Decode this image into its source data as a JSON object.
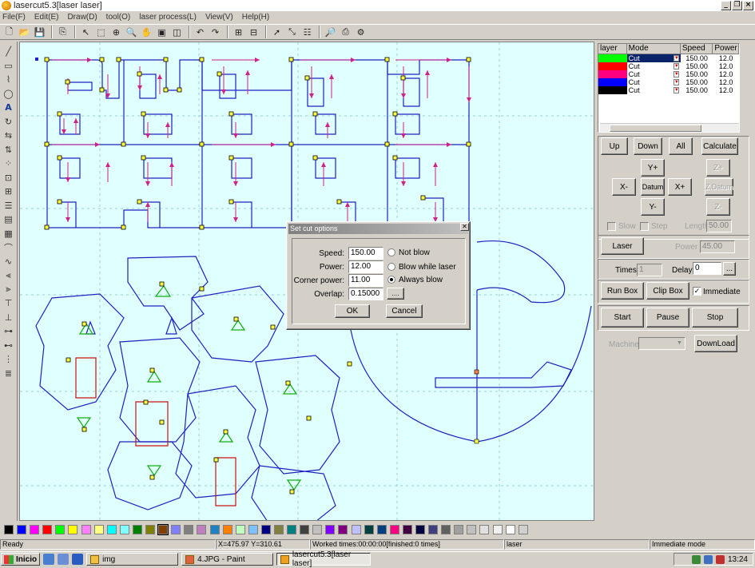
{
  "window": {
    "title": "lasercut5.3[laser laser]",
    "buttons": [
      "_",
      "❐",
      "×"
    ]
  },
  "menu": [
    "File(F)",
    "Edit(E)",
    "Draw(D)",
    "tool(O)",
    "laser process(L)",
    "View(V)",
    "Help(H)"
  ],
  "layers": {
    "headers": [
      "layer",
      "Mode",
      "Speed",
      "Power"
    ],
    "rows": [
      {
        "color": "#00ff00",
        "mode": "Cut",
        "speed": "150.00",
        "power": "12.0"
      },
      {
        "color": "#ff0000",
        "mode": "Cut",
        "speed": "150.00",
        "power": "12.0"
      },
      {
        "color": "#ff0080",
        "mode": "Cut",
        "speed": "150.00",
        "power": "12.0"
      },
      {
        "color": "#0000ff",
        "mode": "Cut",
        "speed": "150.00",
        "power": "12.0"
      },
      {
        "color": "#000000",
        "mode": "Cut",
        "speed": "150.00",
        "power": "12.0"
      }
    ]
  },
  "panel": {
    "up": "Up",
    "down": "Down",
    "all": "All",
    "calculate": "Calculate",
    "yplus": "Y+",
    "xminus": "X-",
    "datum": "Datum",
    "xplus": "X+",
    "yminus": "Y-",
    "zplus": "Z+",
    "zdatum": "Z.Datum",
    "zminus": "Z-",
    "slow": "Slow",
    "step": "Step",
    "length_label": "Length",
    "length_value": "50.00",
    "laser": "Laser",
    "power_label": "Power",
    "power_value": "45.00",
    "times_label": "Times",
    "times_value": "1",
    "delay_label": "Delay",
    "delay_value": "0",
    "delay_more": "...",
    "run_box": "Run Box",
    "clip_box": "Clip Box",
    "immediate": "Immediate",
    "start": "Start",
    "pause": "Pause",
    "stop": "Stop",
    "machine_label": "Machine",
    "download": "DownLoad"
  },
  "dialog": {
    "title": "Set cut options",
    "speed_label": "Speed:",
    "speed": "150.00",
    "power_label": "Power:",
    "power": "12.00",
    "corner_label": "Corner power:",
    "corner": "11.00",
    "overlap_label": "Overlap:",
    "overlap": "0.15000",
    "overlap_more": "....",
    "opt1": "Not blow",
    "opt2": "Blow while laser",
    "opt3": "Always blow",
    "ok": "OK",
    "cancel": "Cancel"
  },
  "palette": [
    "#000000",
    "#0000ff",
    "#ff00ff",
    "#ff0000",
    "#00ff00",
    "#ffff00",
    "#ff80ff",
    "#ffff80",
    "#00ffff",
    "#80ffff",
    "#008000",
    "#808000",
    "#804000",
    "#8080ff",
    "#808080",
    "#c080c0",
    "#2080c0",
    "#ff8000",
    "#c0ffc0",
    "#80c0ff",
    "#000080",
    "#808040",
    "#008080",
    "#404040",
    "#c0c0c0",
    "#8000ff",
    "#800080",
    "#c0c0ff",
    "#004040",
    "#004080",
    "#ff0080",
    "#400040",
    "#000040",
    "#404080",
    "#606060",
    "#a0a0a0",
    "#c0c0c0",
    "#e0e0e0",
    "#f0f0f0",
    "#ffffff",
    "#d0d0d0"
  ],
  "status": {
    "ready": "Ready",
    "coords": "X=475.97 Y=310.61",
    "worked": "Worked times:00:00:00[finished:0 times]",
    "layer": "laser",
    "mode": "Immediate mode"
  },
  "taskbar": {
    "start": "Inicio",
    "tasks": [
      "img",
      "4.JPG - Paint",
      "lasercut5.3[laser laser]"
    ],
    "clock": "13:24"
  }
}
